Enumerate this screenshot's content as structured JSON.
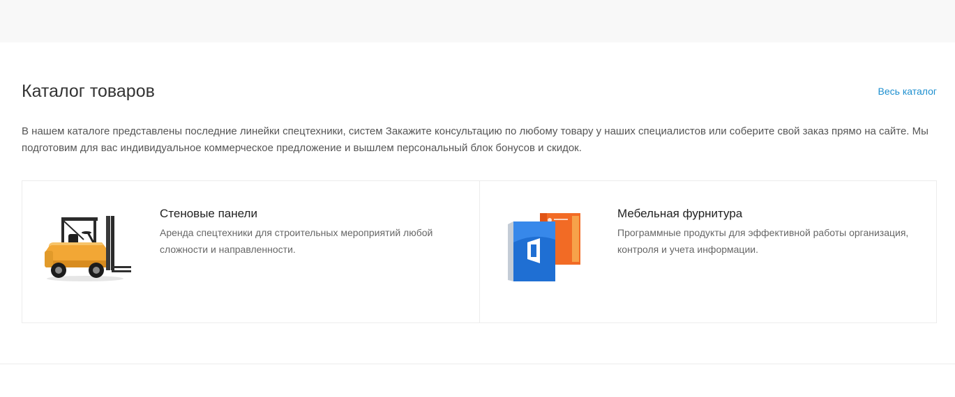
{
  "catalog": {
    "title": "Каталог товаров",
    "all_link": "Весь каталог",
    "intro": "В нашем каталоге представлены последние линейки спецтехники, систем Закажите консультацию по любому товару у наших специалистов или соберите свой заказ прямо на сайте. Мы подготовим для вас индивидуальное коммерческое предложение и вышлем персональный блок бонусов и скидок.",
    "items": [
      {
        "title": "Стеновые панели",
        "description": "Аренда спецтехники для строительных мероприятий любой сложности и направленности.",
        "image": "forklift-image"
      },
      {
        "title": "Мебельная фурнитура",
        "description": "Программные продукты для эффективной работы организация, контроля и учета информации.",
        "image": "software-box-image"
      }
    ]
  },
  "colors": {
    "accent_link": "#1d8fcf",
    "top_strip": "#f8f8f8",
    "border": "#ececec"
  }
}
